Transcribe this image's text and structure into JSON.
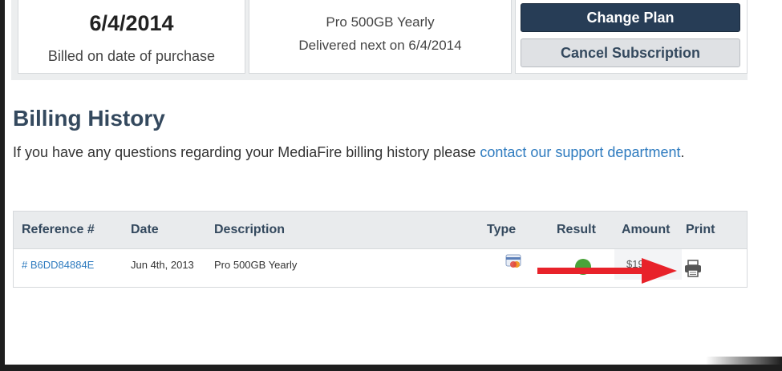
{
  "plan": {
    "date": "6/4/2014",
    "date_caption": "Billed on date of purchase",
    "name": "Pro 500GB Yearly",
    "delivery": "Delivered next on 6/4/2014",
    "change_label": "Change Plan",
    "cancel_label": "Cancel Subscription"
  },
  "billing": {
    "title": "Billing History",
    "intro": "If you have any questions regarding your MediaFire billing history please ",
    "link_text": "contact our support department",
    "trailing": "."
  },
  "table": {
    "headers": {
      "reference": "Reference #",
      "date": "Date",
      "description": "Description",
      "type": "Type",
      "result": "Result",
      "amount": "Amount",
      "print": "Print"
    },
    "rows": [
      {
        "reference": "# B6DD84884E",
        "date": "Jun 4th, 2013",
        "description": "Pro 500GB Yearly",
        "type_icon": "payment-type-icon",
        "result_icon": "success-icon",
        "amount": "$19",
        "print_icon": "printer-icon"
      }
    ]
  },
  "annotation": {
    "arrow_color": "#e8222a",
    "arrow_icon": "red-arrow-pointer"
  }
}
